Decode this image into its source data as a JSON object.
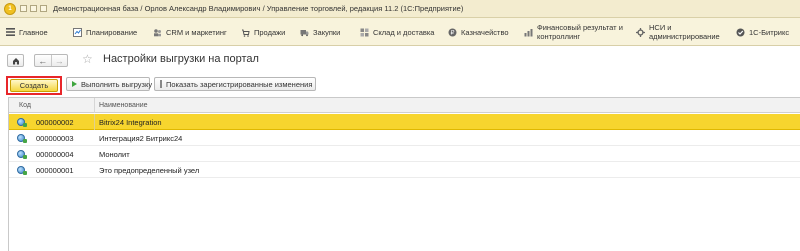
{
  "window": {
    "title": "Демонстрационная база / Орлов Александр Владимирович / Управление торговлей, редакция 11.2  (1С:Предприятие)"
  },
  "sections": [
    {
      "label": "Главное",
      "icon": "menu-icon"
    },
    {
      "label": "Планирование",
      "icon": "planning-icon"
    },
    {
      "label": "CRM и маркетинг",
      "icon": "crm-icon"
    },
    {
      "label": "Продажи",
      "icon": "sales-icon"
    },
    {
      "label": "Закупки",
      "icon": "purchases-icon"
    },
    {
      "label": "Склад и доставка",
      "icon": "warehouse-icon"
    },
    {
      "label": "Казначейство",
      "icon": "treasury-icon"
    },
    {
      "label": "Финансовый результат и контроллинг",
      "line1": "Финансовый результат и",
      "line2": "контроллинг",
      "icon": "finance-icon"
    },
    {
      "label": "НСИ и администрирование",
      "line1": "НСИ и",
      "line2": "администрирование",
      "icon": "nsi-icon"
    },
    {
      "label": "1С-Битрикс",
      "icon": "bitrix-icon"
    }
  ],
  "form": {
    "title": "Настройки выгрузки на портал"
  },
  "commands": {
    "create": "Создать",
    "run_export": "Выполнить выгрузку",
    "show_changes": "Показать зарегистрированные изменения"
  },
  "table": {
    "columns": [
      "Код",
      "Наименование"
    ],
    "rows": [
      {
        "code": "000000002",
        "name": "Bitrix24 Integration",
        "selected": true
      },
      {
        "code": "000000003",
        "name": "Интеграция2 Битрикс24",
        "selected": false
      },
      {
        "code": "000000004",
        "name": "Монолит",
        "selected": false
      },
      {
        "code": "000000001",
        "name": "Это предопределенный узел",
        "selected": false
      }
    ]
  },
  "colors": {
    "accent_yellow": "#f7d52e",
    "highlight_red": "#e8262a",
    "header_bg": "#f3eccf",
    "sections_bg": "#f8f3dc"
  }
}
